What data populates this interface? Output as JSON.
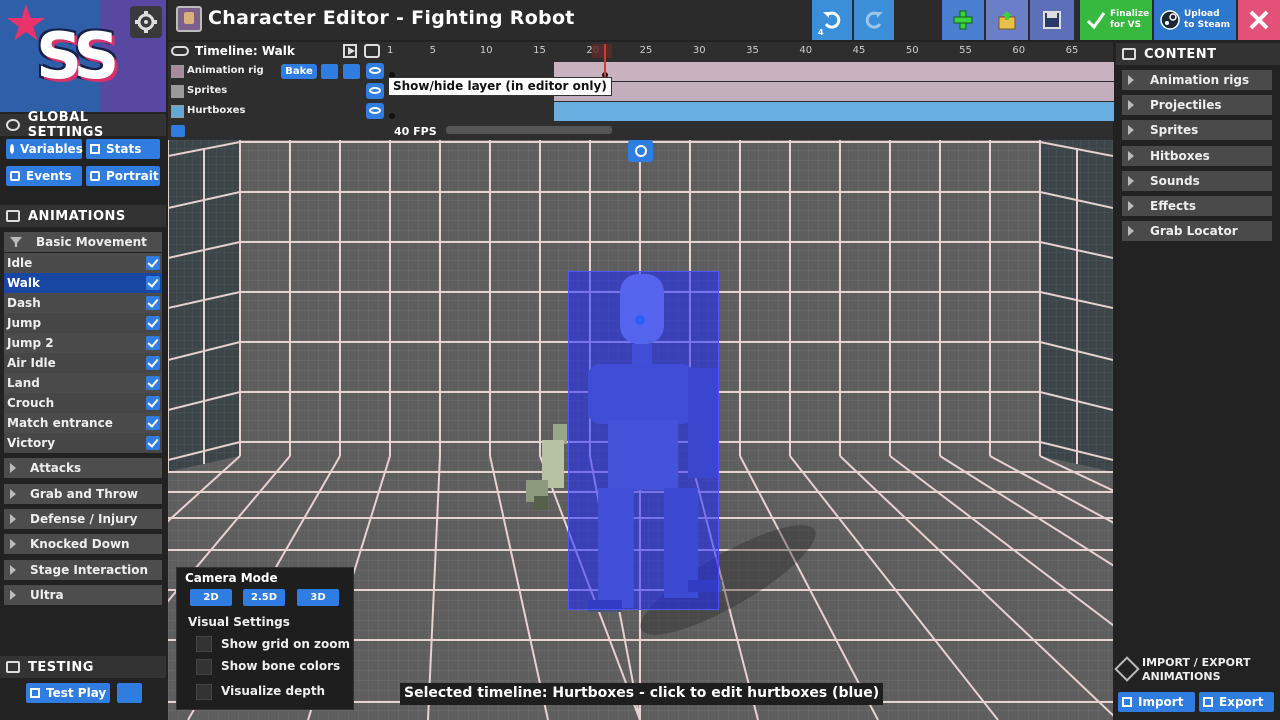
{
  "app": {
    "title": "Character Editor - Fighting Robot",
    "logo_text": "SS",
    "undo_count": "4"
  },
  "toolbar": {
    "finalize_label": "Finalize for VS",
    "upload_label": "Upload to Steam"
  },
  "global_settings": {
    "header": "GLOBAL SETTINGS",
    "buttons": [
      "Variables",
      "Stats",
      "Events",
      "Portrait"
    ]
  },
  "animations": {
    "header": "ANIMATIONS",
    "open_group": "Basic Movement",
    "items": [
      "Idle",
      "Walk",
      "Dash",
      "Jump",
      "Jump 2",
      "Air Idle",
      "Land",
      "Crouch",
      "Match entrance",
      "Victory"
    ],
    "selected": "Walk",
    "groups": [
      "Attacks",
      "Grab and Throw",
      "Defense / Injury",
      "Knocked Down",
      "Stage Interaction",
      "Ultra"
    ]
  },
  "testing": {
    "header": "TESTING",
    "test_play_label": "Test Play"
  },
  "timeline": {
    "title": "Timeline: Walk",
    "ticks": [
      "1",
      "5",
      "10",
      "15",
      "20",
      "25",
      "30",
      "35",
      "40",
      "45",
      "50",
      "55",
      "60",
      "65"
    ],
    "current_frame": 20,
    "layers": [
      {
        "name": "Animation rig",
        "color": "#a88a9a"
      },
      {
        "name": "Sprites",
        "color": "#9a9a9a"
      },
      {
        "name": "Hurtboxes",
        "color": "#5fa8d8"
      }
    ],
    "bake_label": "Bake",
    "tooltip": "Show/hide layer (in editor only)",
    "fps_label": "40 FPS"
  },
  "camera": {
    "mode_label": "Camera Mode",
    "modes": [
      "2D",
      "2.5D",
      "3D"
    ],
    "visual_label": "Visual Settings",
    "options": [
      "Show grid on zoom",
      "Show bone colors",
      "Visualize depth"
    ]
  },
  "status": {
    "text": "Selected timeline: Hurtboxes - click to edit hurtboxes (blue)"
  },
  "content": {
    "header": "CONTENT",
    "items": [
      "Animation rigs",
      "Projectiles",
      "Sprites",
      "Hitboxes",
      "Sounds",
      "Effects",
      "Grab Locator"
    ]
  },
  "import_export": {
    "label": "IMPORT / EXPORT ANIMATIONS",
    "import_label": "Import",
    "export_label": "Export"
  },
  "colors": {
    "accent_blue": "#2f7de0",
    "selected_row": "#1747a3",
    "finalize_green": "#37b93f",
    "close_pink": "#e4527a",
    "hurtbox_blue": "#1e28ff"
  }
}
